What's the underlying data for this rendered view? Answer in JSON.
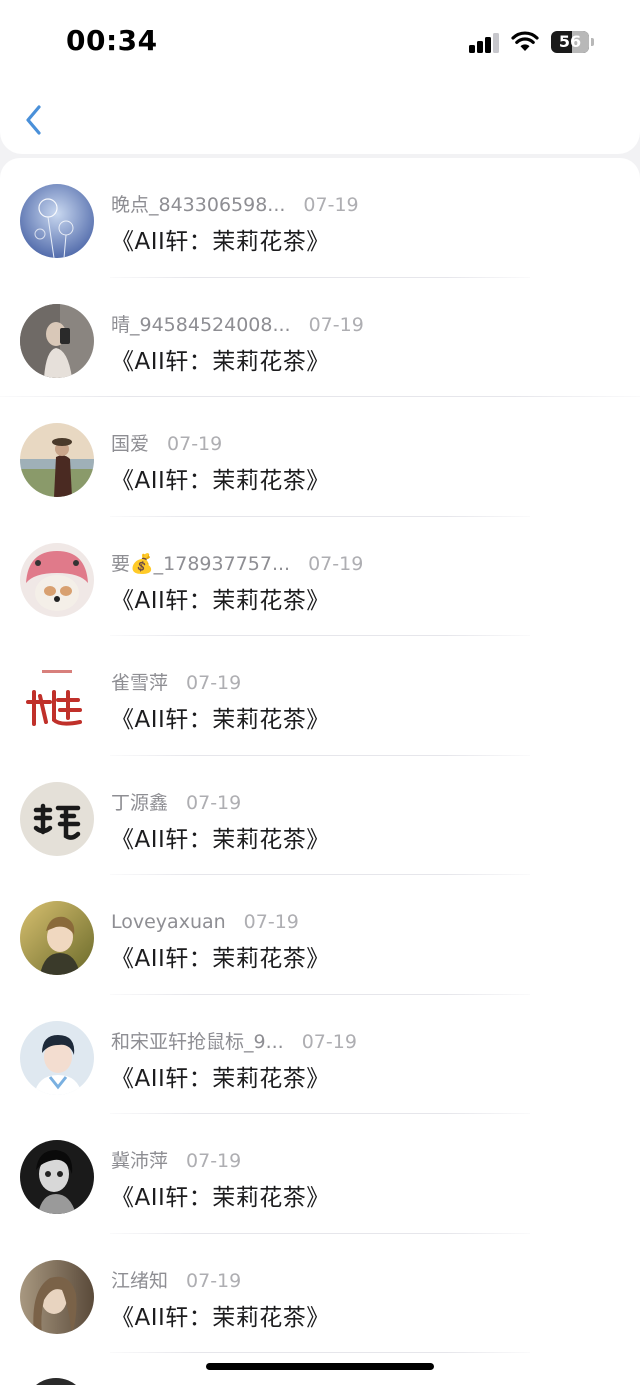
{
  "status_bar": {
    "time": "00:34",
    "battery_level": "56",
    "battery_fraction": 0.56
  },
  "nav": {
    "back_icon": "chevron-left-icon",
    "accent_color": "#4a90d9"
  },
  "comments": [
    {
      "username": "晚点_843306598...",
      "date": "07-19",
      "title": "《AII轩：茉莉花茶》"
    },
    {
      "username": "晴_94584524008...",
      "date": "07-19",
      "title": "《AII轩：茉莉花茶》"
    },
    {
      "username": "国爱",
      "date": "07-19",
      "title": "《AII轩：茉莉花茶》"
    },
    {
      "username": "要💰_178937757...",
      "date": "07-19",
      "title": "《AII轩：茉莉花茶》"
    },
    {
      "username": "雀雪萍",
      "date": "07-19",
      "title": "《AII轩：茉莉花茶》"
    },
    {
      "username": "丁源鑫",
      "date": "07-19",
      "title": "《AII轩：茉莉花茶》"
    },
    {
      "username": "Loveyaxuan",
      "date": "07-19",
      "title": "《AII轩：茉莉花茶》"
    },
    {
      "username": "和宋亚轩抢鼠标_9...",
      "date": "07-19",
      "title": "《AII轩：茉莉花茶》"
    },
    {
      "username": "冀沛萍",
      "date": "07-19",
      "title": "《AII轩：茉莉花茶》"
    },
    {
      "username": "江绪知",
      "date": "07-19",
      "title": "《AII轩：茉莉花茶》"
    }
  ]
}
